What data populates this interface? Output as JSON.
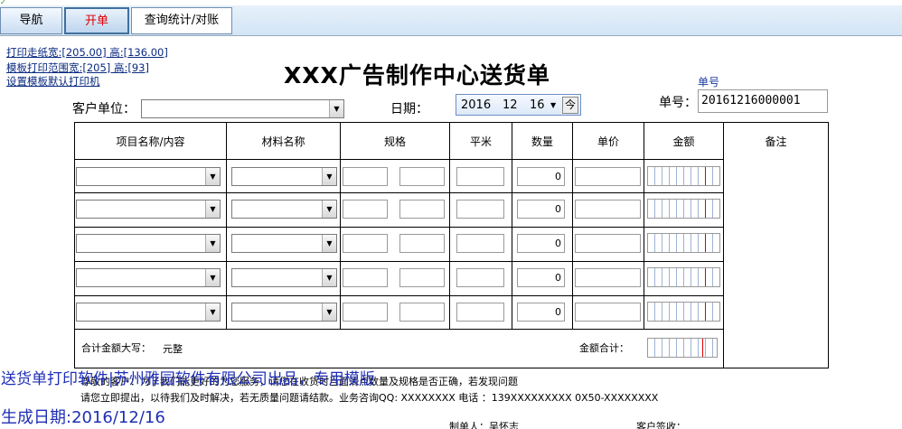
{
  "tabs": [
    {
      "label": "导航"
    },
    {
      "label": "开单"
    },
    {
      "label": "查询统计/对账"
    }
  ],
  "print_links": [
    "打印走纸宽:[205.00] 高:[136.00]",
    "模板打印范围宽:[205] 高:[93]",
    "设置模板默认打印机"
  ],
  "title": "XXX广告制作中心送货单",
  "customer_label": "客户单位：",
  "date_label": "日期：",
  "date": {
    "year": "2016",
    "month": "12",
    "day": "16",
    "today_label": "今"
  },
  "order_caption": "单号",
  "order_label": "单号：",
  "order_no": "20161216000001",
  "headers": [
    "项目名称/内容",
    "材料名称",
    "规格",
    "平米",
    "数量",
    "单价",
    "金额",
    "备注"
  ],
  "rows": [
    {
      "qty": "0"
    },
    {
      "qty": "0"
    },
    {
      "qty": "0"
    },
    {
      "qty": "0"
    },
    {
      "qty": "0"
    }
  ],
  "total_words_label": "合计金额大写：",
  "total_words_value": "元整",
  "total_amount_label": "金额合计：",
  "notes": {
    "line1": "尊敬的客户：为了我们能更好的为您服务，请您在收货时当面清点数量及规格是否正确，若发现问题",
    "line2": "请您立即提出，以待我们及时解决，若无质量问题请结款。业务咨询QQ: XXXXXXXX 电话 ：139XXXXXXXXX  0X50-XXXXXXXX"
  },
  "watermark": {
    "line1": "送货单打印软件|苏州雅园软件有限公司出品，专用模版",
    "line2": "生成日期:2016/12/16"
  },
  "signatures": {
    "maker": "制单人：吴怀志",
    "customer": "客户签收："
  },
  "colors": {
    "accent_red": "#e00000",
    "watermark_blue": "#1f2fb5"
  }
}
